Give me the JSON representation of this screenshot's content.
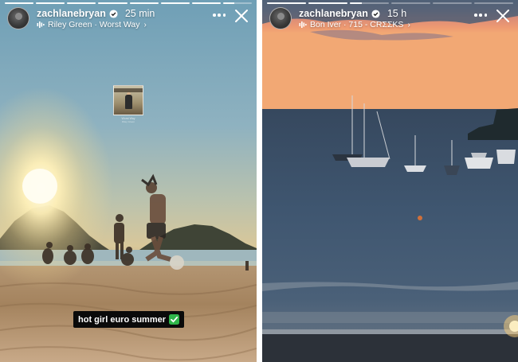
{
  "stories": [
    {
      "username": "zachlanebryan",
      "time_ago": "25 min",
      "music": "Riley Green · Worst Way",
      "caption": "hot girl euro summer",
      "caption_emoji_icon": "check-mark-button-icon",
      "sticker": {
        "title": "Worst Way",
        "artist": "Riley Green"
      },
      "progress": [
        1,
        1,
        1,
        1,
        1,
        1,
        1,
        0.4
      ]
    },
    {
      "username": "zachlanebryan",
      "time_ago": "15 h",
      "music": "Bon Iver · 715 - CRΣΣKS",
      "progress": [
        1,
        1,
        0.3,
        0,
        0,
        0
      ]
    }
  ],
  "colors": {
    "caption_bg": "#0a0a0a",
    "check_green": "#2fb64a",
    "verified_blue": "#ffffff"
  },
  "icons": [
    "verified-badge-icon",
    "music-bars-icon",
    "chevron-right-icon",
    "more-icon",
    "close-icon",
    "check-mark-button-icon"
  ]
}
